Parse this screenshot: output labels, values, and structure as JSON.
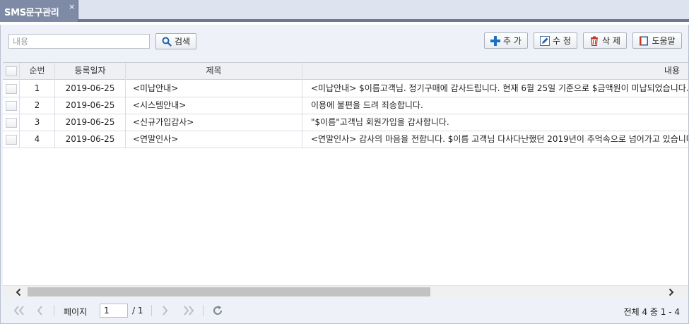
{
  "tab": {
    "label": "SMS문구관리",
    "close": "×"
  },
  "toolbar": {
    "search_placeholder": "내용",
    "search_label": "검색",
    "add_label": "추 가",
    "edit_label": "수 정",
    "delete_label": "삭 제",
    "help_label": "도움말"
  },
  "table": {
    "columns": [
      "순번",
      "등록일자",
      "제목",
      "내용"
    ],
    "rows": [
      {
        "no": "1",
        "date": "2019-06-25",
        "title": "<미납안내>",
        "content": "<미납안내> $이름고객님. 정기구매에 감사드립니다. 현재 6월 25일 기준으로 $금액원이 미납되었습니다."
      },
      {
        "no": "2",
        "date": "2019-06-25",
        "title": "<시스템안내>",
        "content": "이용에 불편을 드려 죄송합니다."
      },
      {
        "no": "3",
        "date": "2019-06-25",
        "title": "<신규가입감사>",
        "content": "\"$이름\"고객님 회원가입을 감사합니다."
      },
      {
        "no": "4",
        "date": "2019-06-25",
        "title": "<연말인사>",
        "content": "<연말인사> 감사의 마음을 전합니다. $이름 고객님 다사다난했던 2019년이 추억속으로 넘어가고 있습니다."
      }
    ]
  },
  "pager": {
    "page_label": "페이지",
    "current_page": "1",
    "total_pages": "/ 1",
    "summary": "전체 4 중 1 - 4"
  },
  "colors": {
    "tab_bg": "#7f8ba6",
    "accent_bar": "#6d7894",
    "panel_bg": "#eef1f7",
    "add_icon": "#1f6fc0"
  }
}
